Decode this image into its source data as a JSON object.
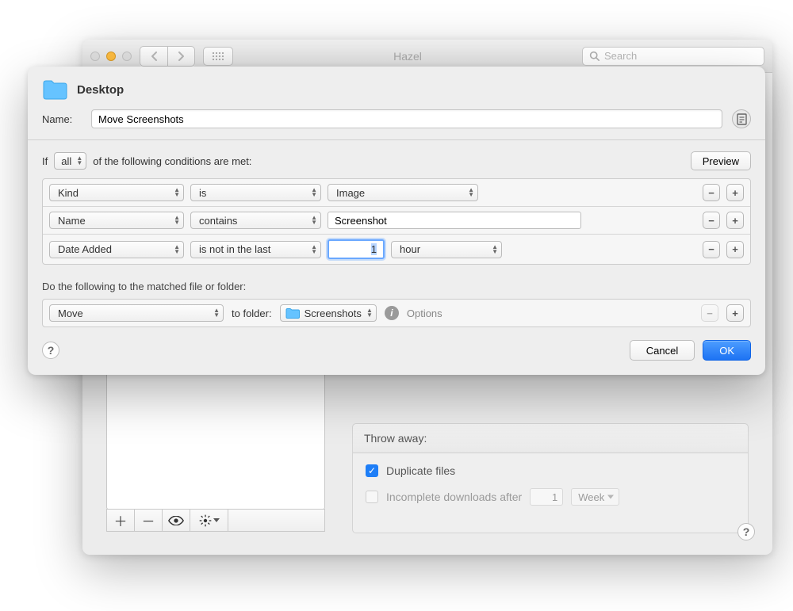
{
  "titlebar": {
    "title": "Hazel",
    "search_placeholder": "Search"
  },
  "background": {
    "throw_away_header": "Throw away:",
    "duplicate_label": "Duplicate files",
    "incomplete_label": "Incomplete downloads after",
    "incomplete_value": "1",
    "incomplete_unit": "Week"
  },
  "sheet": {
    "folder_name": "Desktop",
    "name_label": "Name:",
    "rule_name": "Move Screenshots",
    "if_prefix": "If",
    "if_scope": "all",
    "if_suffix": "of the following conditions are met:",
    "preview": "Preview",
    "conditions": [
      {
        "attr": "Kind",
        "op": "is",
        "val_popup": "Image"
      },
      {
        "attr": "Name",
        "op": "contains",
        "val_text": "Screenshot"
      },
      {
        "attr": "Date Added",
        "op": "is not in the last",
        "val_num": "1",
        "val_unit": "hour"
      }
    ],
    "do_label": "Do the following to the matched file or folder:",
    "action": {
      "verb": "Move",
      "to_label": "to folder:",
      "folder": "Screenshots",
      "options": "Options"
    },
    "cancel": "Cancel",
    "ok": "OK"
  }
}
